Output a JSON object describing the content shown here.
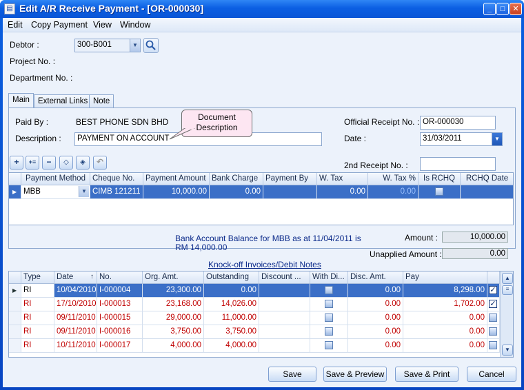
{
  "window": {
    "title": "Edit A/R Receive Payment - [OR-000030]"
  },
  "menu": [
    "Edit",
    "Copy Payment",
    "View",
    "Window"
  ],
  "header": {
    "debtor_label": "Debtor :",
    "debtor_value": "300-B001",
    "project_label": "Project No. :",
    "department_label": "Department No. :"
  },
  "tabs": [
    "Main",
    "External Links",
    "Note"
  ],
  "main": {
    "paid_by_label": "Paid By :",
    "paid_by_value": "BEST PHONE SDN BHD",
    "description_label": "Description :",
    "description_value": "PAYMENT ON ACCOUNT",
    "callout_line1": "Document",
    "callout_line2": "Description",
    "or_no_label": "Official Receipt No. :",
    "or_no_value": "OR-000030",
    "date_label": "Date :",
    "date_value": "31/03/2011",
    "second_receipt_label": "2nd Receipt No. :",
    "second_receipt_value": ""
  },
  "payment_grid": {
    "columns": [
      "Payment Method",
      "Cheque No.",
      "Payment Amount",
      "Bank Charge",
      "Payment By",
      "W. Tax",
      "W. Tax %",
      "Is RCHQ",
      "RCHQ Date"
    ],
    "row": {
      "method": "MBB",
      "cheque": "CIMB 121211",
      "amount": "10,000.00",
      "bank_charge": "0.00",
      "payment_by": "",
      "w_tax": "0.00",
      "w_tax_pct": "0.00",
      "is_rchq": false,
      "rchq_date": ""
    }
  },
  "balance": {
    "line1": "Bank Account Balance for MBB as at 11/04/2011 is",
    "line2": "RM 14,000.00",
    "amount_label": "Amount :",
    "amount_value": "10,000.00",
    "unapplied_label": "Unapplied Amount :",
    "unapplied_value": "0.00"
  },
  "knockoff": {
    "title": "Knock-off Invoices/Debit Notes",
    "columns": [
      "Type",
      "Date",
      "No.",
      "Org. Amt.",
      "Outstanding",
      "Discount ...",
      "With Di...",
      "Disc. Amt.",
      "Pay"
    ],
    "rows": [
      {
        "type": "RI",
        "date": "10/04/2010",
        "no": "I-000004",
        "org": "23,300.00",
        "outstanding": "0.00",
        "disc_amt": "0.00",
        "pay": "8,298.00",
        "checked": true,
        "red": false,
        "selected": true
      },
      {
        "type": "RI",
        "date": "17/10/2010",
        "no": "I-000013",
        "org": "23,168.00",
        "outstanding": "14,026.00",
        "disc_amt": "0.00",
        "pay": "1,702.00",
        "checked": true,
        "red": true,
        "selected": false
      },
      {
        "type": "RI",
        "date": "09/11/2010",
        "no": "I-000015",
        "org": "29,000.00",
        "outstanding": "11,000.00",
        "disc_amt": "0.00",
        "pay": "0.00",
        "checked": false,
        "red": true,
        "selected": false
      },
      {
        "type": "RI",
        "date": "09/11/2010",
        "no": "I-000016",
        "org": "3,750.00",
        "outstanding": "3,750.00",
        "disc_amt": "0.00",
        "pay": "0.00",
        "checked": false,
        "red": true,
        "selected": false
      },
      {
        "type": "RI",
        "date": "10/11/2010",
        "no": "I-000017",
        "org": "4,000.00",
        "outstanding": "4,000.00",
        "disc_amt": "0.00",
        "pay": "0.00",
        "checked": false,
        "red": true,
        "selected": false
      }
    ]
  },
  "buttons": {
    "save": "Save",
    "save_preview": "Save & Preview",
    "save_print": "Save & Print",
    "cancel": "Cancel"
  },
  "icons": [
    "search-icon",
    "add-icon",
    "insert-icon",
    "delete-icon",
    "move-up-icon",
    "move-down-icon",
    "undo-icon"
  ]
}
